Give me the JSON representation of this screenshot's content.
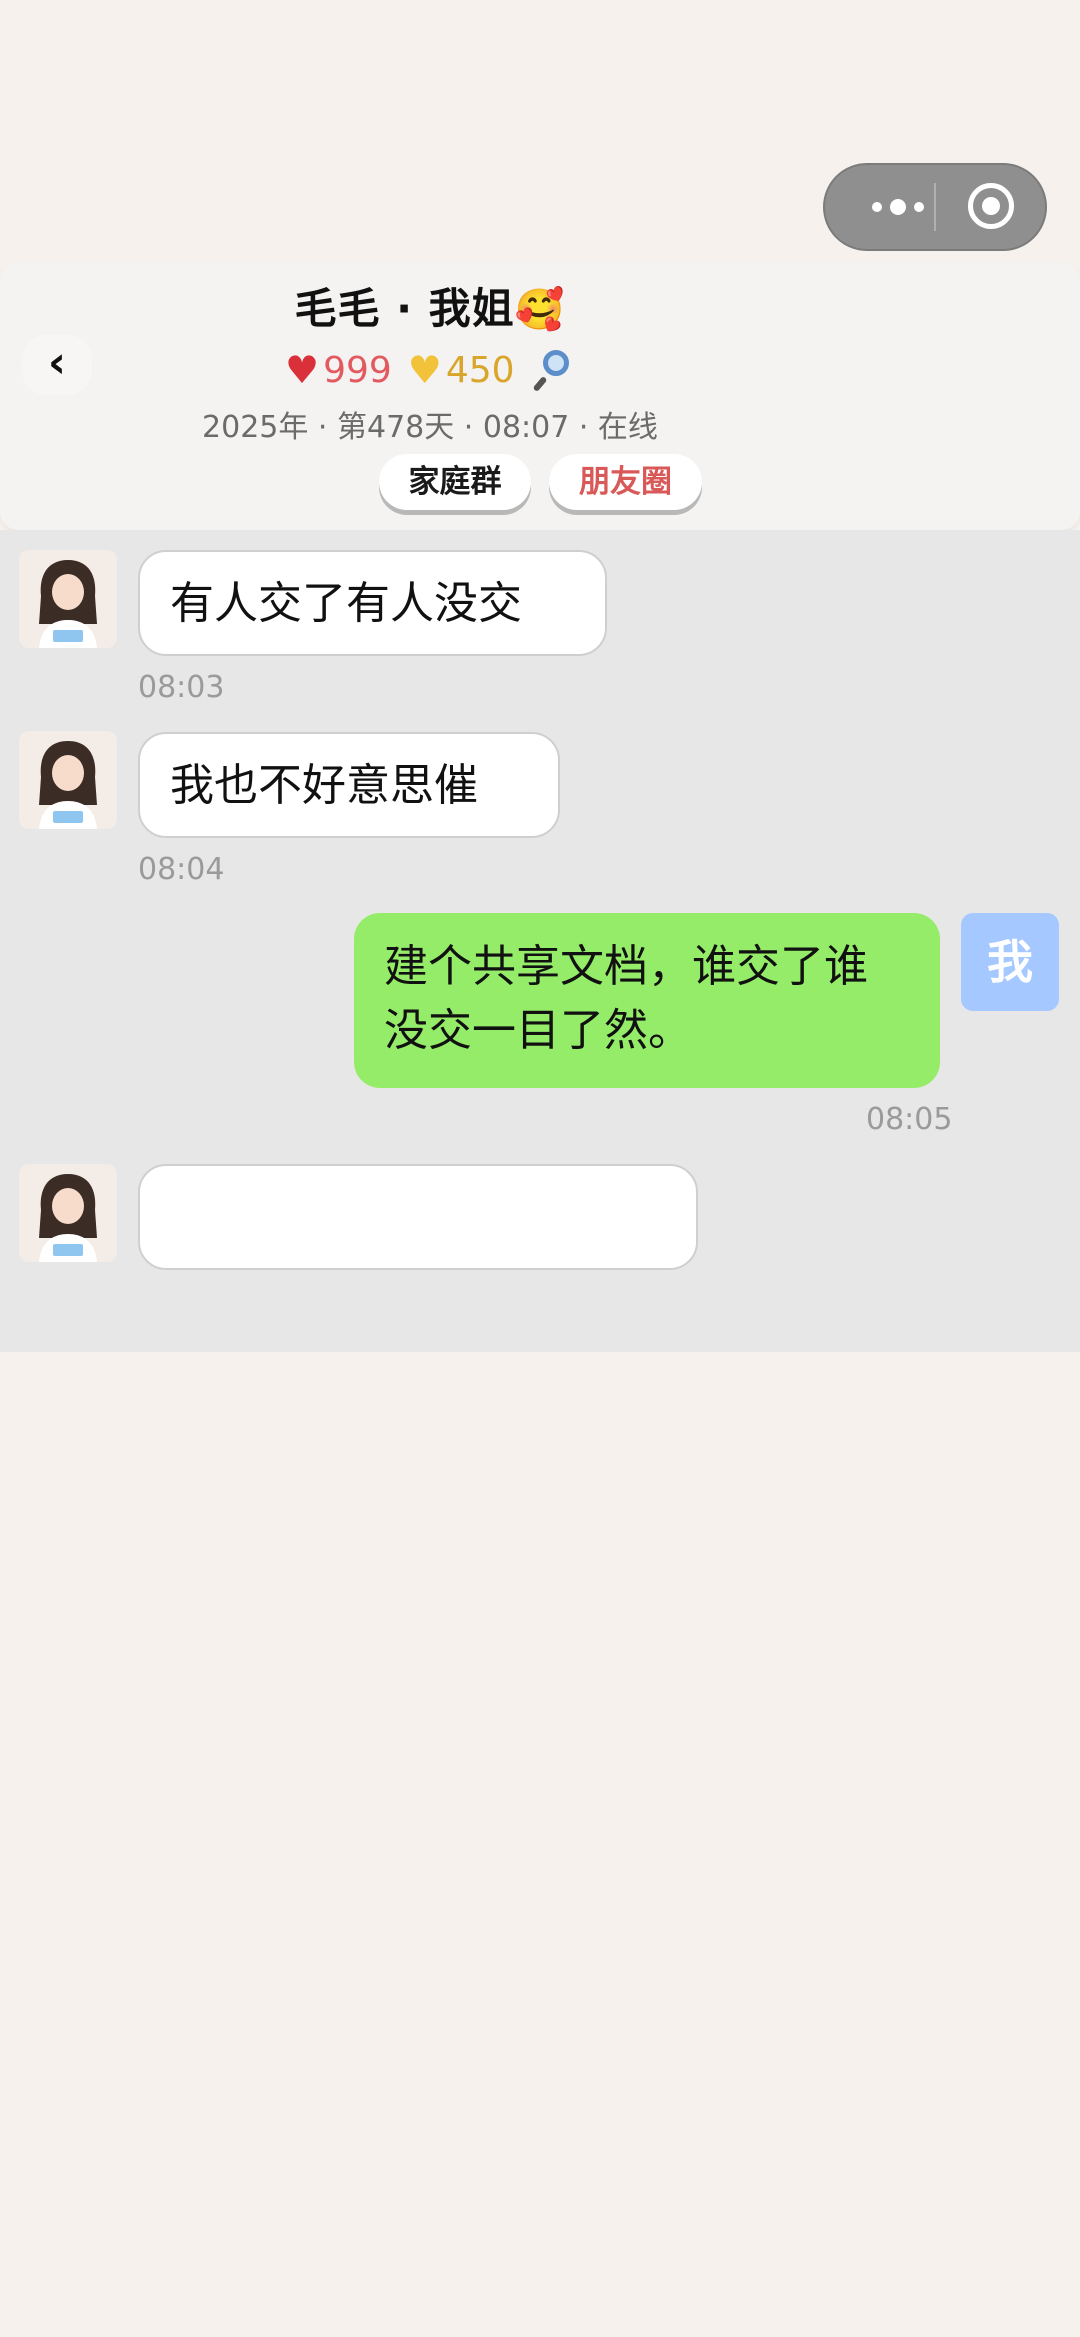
{
  "capsule": {
    "more_icon": "more-dots-icon",
    "close_icon": "target-icon"
  },
  "header": {
    "back_label": "‹",
    "title": "毛毛 · 我姐",
    "title_emoji": "🥰",
    "stats": {
      "heart_red_icon": "♥",
      "red_value": "999",
      "heart_yellow_icon": "♥",
      "yellow_value": "450",
      "search_icon": "magnifier-icon"
    },
    "meta": "2025年 · 第478天 · 08:07 · 在线",
    "tabs": [
      {
        "label": "家庭群",
        "color": "#1a1a1a"
      },
      {
        "label": "朋友圈",
        "color": "#d95858"
      }
    ]
  },
  "messages": [
    {
      "side": "in",
      "text": "有人交了有人没交",
      "time": "08:03"
    },
    {
      "side": "in",
      "text": "我也不好意思催",
      "time": "08:04"
    },
    {
      "side": "out",
      "text": "建个共享文档，谁交了谁没交一目了然。",
      "time": "08:05",
      "avatar_label": "我"
    },
    {
      "side": "in",
      "text": "",
      "time": ""
    }
  ],
  "colors": {
    "out_bubble": "#95ec69",
    "me_avatar": "#a4c8ff",
    "chat_bg": "#e7e7e7",
    "page_bg": "#f6f1ec"
  }
}
